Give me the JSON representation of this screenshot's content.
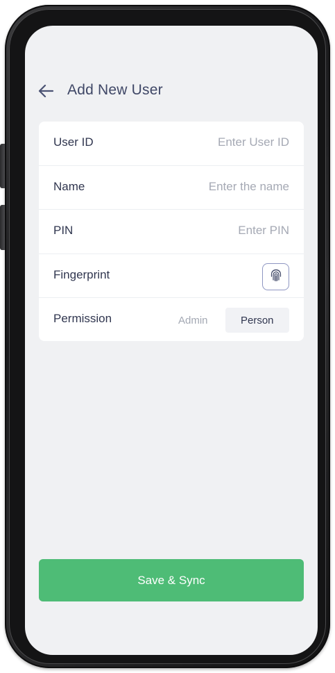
{
  "header": {
    "back_icon": "arrow-left-icon",
    "title": "Add New User"
  },
  "form": {
    "user_id": {
      "label": "User ID",
      "value": "",
      "placeholder": "Enter User ID"
    },
    "name": {
      "label": "Name",
      "value": "",
      "placeholder": "Enter the name"
    },
    "pin": {
      "label": "PIN",
      "value": "",
      "placeholder": "Enter PIN"
    },
    "fingerprint": {
      "label": "Fingerprint",
      "icon": "fingerprint-icon"
    },
    "permission": {
      "label": "Permission",
      "options": [
        "Admin",
        "Person"
      ],
      "selected": "Person"
    }
  },
  "footer": {
    "save_label": "Save & Sync"
  },
  "colors": {
    "screen_background": "#f0f1f3",
    "title_text": "#3f4766",
    "label_text": "#30364f",
    "placeholder_text": "#a5a9b4",
    "fingerprint_border": "#8e96c2",
    "segment_active_bg": "#f1f2f5",
    "save_button": "#4ebc76",
    "phone_frame": "#1a1a1c"
  }
}
